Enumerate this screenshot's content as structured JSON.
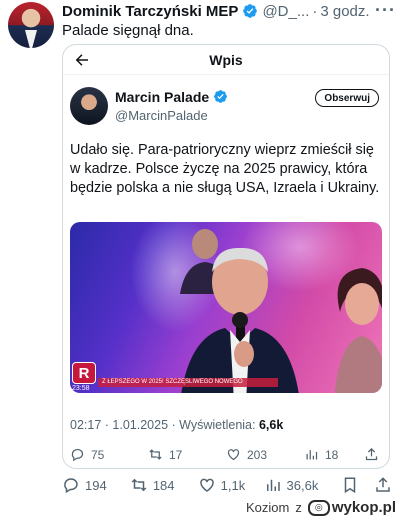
{
  "post": {
    "author_name": "Dominik Tarczyński MEP",
    "handle": "@D_...",
    "separator": "·",
    "time": "3 godz.",
    "text": "Palade sięgnął dna.",
    "more_icon": "more-horizontal-icon"
  },
  "embed": {
    "header_title": "Wpis",
    "author_name": "Marcin Palade",
    "handle": "@MarcinPalade",
    "follow_label": "Obserwuj",
    "text": "Udało się. Para-patrioryczny wieprz zmieścił się w kadrze. Polsce życzę na 2025 prawicy, która będzie polska a nie sługą USA, Izraela i Ukrainy.",
    "image": {
      "logo": "R",
      "ticker": "Z ŁEPSZEGO W 2025! SZCZĘŚLIWEGO NOWEGO",
      "clock": "23:58"
    },
    "meta": {
      "time": "02:17",
      "separator": "·",
      "date": "1.01.2025",
      "views_label": "Wyświetlenia:",
      "views_value": "6,6k"
    },
    "stats": {
      "replies": "75",
      "reposts": "17",
      "likes": "203",
      "views": "18"
    }
  },
  "stats": {
    "replies": "194",
    "reposts": "184",
    "likes": "1,1k",
    "views": "36,6k"
  },
  "watermark": {
    "text": "Koziom",
    "prefix": "z",
    "brand": "wykop.pl"
  },
  "colors": {
    "verified": "#1d9bf0",
    "muted": "#536471",
    "text": "#0f1419"
  }
}
